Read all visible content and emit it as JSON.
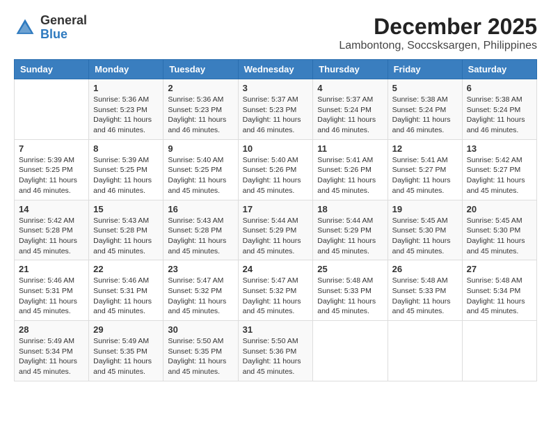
{
  "logo": {
    "general": "General",
    "blue": "Blue"
  },
  "title": {
    "month_year": "December 2025",
    "location": "Lambontong, Soccsksargen, Philippines"
  },
  "header": {
    "days": [
      "Sunday",
      "Monday",
      "Tuesday",
      "Wednesday",
      "Thursday",
      "Friday",
      "Saturday"
    ]
  },
  "weeks": [
    {
      "cells": [
        {
          "day": "",
          "content": ""
        },
        {
          "day": "1",
          "content": "Sunrise: 5:36 AM\nSunset: 5:23 PM\nDaylight: 11 hours and 46 minutes."
        },
        {
          "day": "2",
          "content": "Sunrise: 5:36 AM\nSunset: 5:23 PM\nDaylight: 11 hours and 46 minutes."
        },
        {
          "day": "3",
          "content": "Sunrise: 5:37 AM\nSunset: 5:23 PM\nDaylight: 11 hours and 46 minutes."
        },
        {
          "day": "4",
          "content": "Sunrise: 5:37 AM\nSunset: 5:24 PM\nDaylight: 11 hours and 46 minutes."
        },
        {
          "day": "5",
          "content": "Sunrise: 5:38 AM\nSunset: 5:24 PM\nDaylight: 11 hours and 46 minutes."
        },
        {
          "day": "6",
          "content": "Sunrise: 5:38 AM\nSunset: 5:24 PM\nDaylight: 11 hours and 46 minutes."
        }
      ]
    },
    {
      "cells": [
        {
          "day": "7",
          "content": "Sunrise: 5:39 AM\nSunset: 5:25 PM\nDaylight: 11 hours and 46 minutes."
        },
        {
          "day": "8",
          "content": "Sunrise: 5:39 AM\nSunset: 5:25 PM\nDaylight: 11 hours and 46 minutes."
        },
        {
          "day": "9",
          "content": "Sunrise: 5:40 AM\nSunset: 5:25 PM\nDaylight: 11 hours and 45 minutes."
        },
        {
          "day": "10",
          "content": "Sunrise: 5:40 AM\nSunset: 5:26 PM\nDaylight: 11 hours and 45 minutes."
        },
        {
          "day": "11",
          "content": "Sunrise: 5:41 AM\nSunset: 5:26 PM\nDaylight: 11 hours and 45 minutes."
        },
        {
          "day": "12",
          "content": "Sunrise: 5:41 AM\nSunset: 5:27 PM\nDaylight: 11 hours and 45 minutes."
        },
        {
          "day": "13",
          "content": "Sunrise: 5:42 AM\nSunset: 5:27 PM\nDaylight: 11 hours and 45 minutes."
        }
      ]
    },
    {
      "cells": [
        {
          "day": "14",
          "content": "Sunrise: 5:42 AM\nSunset: 5:28 PM\nDaylight: 11 hours and 45 minutes."
        },
        {
          "day": "15",
          "content": "Sunrise: 5:43 AM\nSunset: 5:28 PM\nDaylight: 11 hours and 45 minutes."
        },
        {
          "day": "16",
          "content": "Sunrise: 5:43 AM\nSunset: 5:28 PM\nDaylight: 11 hours and 45 minutes."
        },
        {
          "day": "17",
          "content": "Sunrise: 5:44 AM\nSunset: 5:29 PM\nDaylight: 11 hours and 45 minutes."
        },
        {
          "day": "18",
          "content": "Sunrise: 5:44 AM\nSunset: 5:29 PM\nDaylight: 11 hours and 45 minutes."
        },
        {
          "day": "19",
          "content": "Sunrise: 5:45 AM\nSunset: 5:30 PM\nDaylight: 11 hours and 45 minutes."
        },
        {
          "day": "20",
          "content": "Sunrise: 5:45 AM\nSunset: 5:30 PM\nDaylight: 11 hours and 45 minutes."
        }
      ]
    },
    {
      "cells": [
        {
          "day": "21",
          "content": "Sunrise: 5:46 AM\nSunset: 5:31 PM\nDaylight: 11 hours and 45 minutes."
        },
        {
          "day": "22",
          "content": "Sunrise: 5:46 AM\nSunset: 5:31 PM\nDaylight: 11 hours and 45 minutes."
        },
        {
          "day": "23",
          "content": "Sunrise: 5:47 AM\nSunset: 5:32 PM\nDaylight: 11 hours and 45 minutes."
        },
        {
          "day": "24",
          "content": "Sunrise: 5:47 AM\nSunset: 5:32 PM\nDaylight: 11 hours and 45 minutes."
        },
        {
          "day": "25",
          "content": "Sunrise: 5:48 AM\nSunset: 5:33 PM\nDaylight: 11 hours and 45 minutes."
        },
        {
          "day": "26",
          "content": "Sunrise: 5:48 AM\nSunset: 5:33 PM\nDaylight: 11 hours and 45 minutes."
        },
        {
          "day": "27",
          "content": "Sunrise: 5:48 AM\nSunset: 5:34 PM\nDaylight: 11 hours and 45 minutes."
        }
      ]
    },
    {
      "cells": [
        {
          "day": "28",
          "content": "Sunrise: 5:49 AM\nSunset: 5:34 PM\nDaylight: 11 hours and 45 minutes."
        },
        {
          "day": "29",
          "content": "Sunrise: 5:49 AM\nSunset: 5:35 PM\nDaylight: 11 hours and 45 minutes."
        },
        {
          "day": "30",
          "content": "Sunrise: 5:50 AM\nSunset: 5:35 PM\nDaylight: 11 hours and 45 minutes."
        },
        {
          "day": "31",
          "content": "Sunrise: 5:50 AM\nSunset: 5:36 PM\nDaylight: 11 hours and 45 minutes."
        },
        {
          "day": "",
          "content": ""
        },
        {
          "day": "",
          "content": ""
        },
        {
          "day": "",
          "content": ""
        }
      ]
    }
  ]
}
